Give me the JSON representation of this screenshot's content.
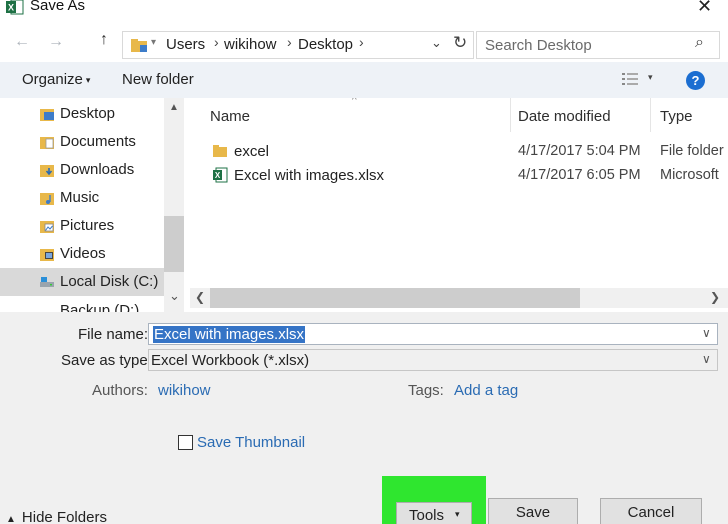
{
  "window": {
    "title": "Save As",
    "close_glyph": "✕",
    "app_icon": "excel-icon"
  },
  "navigation": {
    "back_glyph": "←",
    "forward_glyph": "→",
    "up_glyph": "↑",
    "breadcrumb": [
      "Users",
      "wikihow",
      "Desktop"
    ],
    "crumb_sep": "›",
    "dropdown_glyph": "⌄",
    "refresh_glyph": "↻",
    "search_placeholder": "Search Desktop",
    "search_glyph": "⌕"
  },
  "toolbar": {
    "organize_label": "Organize",
    "new_folder_label": "New folder",
    "caret_glyph": "▾",
    "help_label": "?"
  },
  "nav_pane": {
    "items": [
      {
        "label": "Desktop",
        "icon": "desktop-icon",
        "selected": false
      },
      {
        "label": "Documents",
        "icon": "documents-icon",
        "selected": false
      },
      {
        "label": "Downloads",
        "icon": "downloads-icon",
        "selected": false
      },
      {
        "label": "Music",
        "icon": "music-icon",
        "selected": false
      },
      {
        "label": "Pictures",
        "icon": "pictures-icon",
        "selected": false
      },
      {
        "label": "Videos",
        "icon": "videos-icon",
        "selected": false
      },
      {
        "label": "Local Disk (C:)",
        "icon": "local-disk-icon",
        "selected": true
      }
    ],
    "partial_item": "Backup (D:)",
    "up_glyph": "▲",
    "down_glyph": "⌄"
  },
  "file_list": {
    "columns": [
      "Name",
      "Date modified",
      "Type"
    ],
    "sort_glyph": "^",
    "rows": [
      {
        "name": "excel",
        "date": "4/17/2017 5:04 PM",
        "type": "File folder",
        "icon": "folder-icon"
      },
      {
        "name": "Excel with images.xlsx",
        "date": "4/17/2017 6:05 PM",
        "type": "Microsoft",
        "icon": "excel-file-icon"
      }
    ],
    "left_glyph": "❮",
    "right_glyph": "❯"
  },
  "form": {
    "file_name_label": "File name:",
    "file_name_value": "Excel with images.xlsx",
    "save_type_label": "Save as type:",
    "save_type_value": "Excel Workbook (*.xlsx)",
    "authors_label": "Authors:",
    "authors_value": "wikihow",
    "tags_label": "Tags:",
    "tags_value": "Add a tag",
    "thumbnail_label": "Save Thumbnail",
    "thumbnail_checked": false,
    "dd_glyph": "∨"
  },
  "footer": {
    "hide_folders_label": "Hide Folders",
    "hide_glyph": "▲",
    "tools_label": "Tools",
    "save_label": "Save",
    "cancel_label": "Cancel",
    "highlight_color": "#2fe62f"
  }
}
